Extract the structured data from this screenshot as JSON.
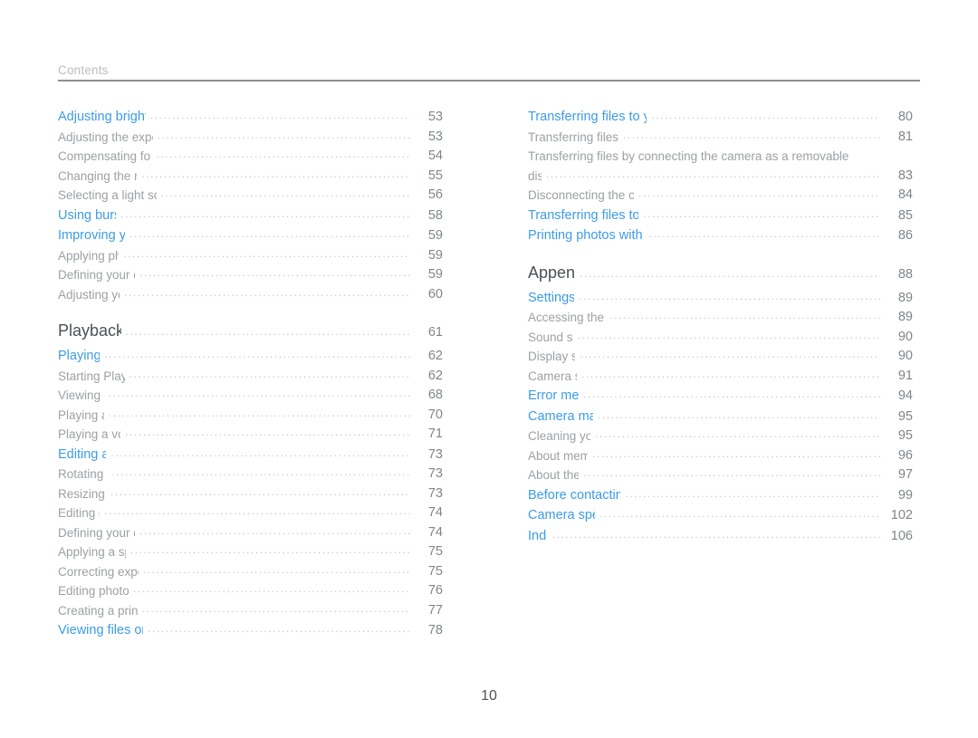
{
  "document": {
    "header_label": "Contents",
    "folio": "10",
    "accent_color": "#3c9ce8",
    "topic_color": "#9ba1a5",
    "section_color": "#4a5156",
    "page_number_color": "#7f868b",
    "rule_color": "#8a8f93"
  },
  "columns": {
    "left": [
      {
        "kind": "chapter",
        "label": "Adjusting brightness and colour",
        "page": "53"
      },
      {
        "kind": "topic",
        "label": "Adjusting the exposure manually (EV)",
        "page": "53"
      },
      {
        "kind": "topic",
        "label": "Compensating for backlighting (ACB)",
        "page": "54"
      },
      {
        "kind": "topic",
        "label": "Changing the metering option",
        "page": "55"
      },
      {
        "kind": "topic",
        "label": "Selecting a light source (White balance)",
        "page": "56"
      },
      {
        "kind": "chapter",
        "label": "Using burst modes",
        "page": "58"
      },
      {
        "kind": "chapter",
        "label": "Improving your photos",
        "page": "59"
      },
      {
        "kind": "topic",
        "label": "Applying photo styles",
        "page": "59"
      },
      {
        "kind": "topic",
        "label": "Defining your own RGB tone",
        "page": "59"
      },
      {
        "kind": "topic",
        "label": "Adjusting your photos",
        "page": "60"
      },
      {
        "kind": "section",
        "label": "Playback/Editing",
        "page": "61"
      },
      {
        "kind": "chapter",
        "label": "Playing back",
        "page": "62"
      },
      {
        "kind": "topic",
        "label": "Starting Playback mode",
        "page": "62"
      },
      {
        "kind": "topic",
        "label": "Viewing photos",
        "page": "68"
      },
      {
        "kind": "topic",
        "label": "Playing a video",
        "page": "70"
      },
      {
        "kind": "topic",
        "label": "Playing a voice memo",
        "page": "71"
      },
      {
        "kind": "chapter",
        "label": "Editing a photo",
        "page": "73"
      },
      {
        "kind": "topic",
        "label": "Rotating a photo",
        "page": "73"
      },
      {
        "kind": "topic",
        "label": "Resizing photos",
        "page": "73"
      },
      {
        "kind": "topic",
        "label": "Editing colour",
        "page": "74"
      },
      {
        "kind": "topic",
        "label": "Defining your own RGB tone",
        "page": "74"
      },
      {
        "kind": "topic",
        "label": "Applying a special effect",
        "page": "75"
      },
      {
        "kind": "topic",
        "label": "Correcting exposure problems",
        "page": "75"
      },
      {
        "kind": "topic",
        "label": "Editing photos of portraits",
        "page": "76"
      },
      {
        "kind": "topic",
        "label": "Creating a print order (DPOF)",
        "page": "77"
      },
      {
        "kind": "chapter",
        "label": "Viewing files on a TV or HDTV",
        "page": "78"
      }
    ],
    "right": [
      {
        "kind": "chapter",
        "label": "Transferring files to your computer (for Windows)",
        "page": "80"
      },
      {
        "kind": "topic",
        "label": "Transferring files using Intelli-studio",
        "page": "81"
      },
      {
        "kind": "topic_wrapped",
        "label_line1": "Transferring files by connecting the camera as a removable",
        "label_line2": "disk",
        "page": "83"
      },
      {
        "kind": "topic",
        "label": "Disconnecting the camera (for Windows XP)",
        "page": "84"
      },
      {
        "kind": "chapter",
        "label": "Transferring files to your computer (for Mac)",
        "page": "85"
      },
      {
        "kind": "chapter",
        "label": "Printing photos with a photo printer (PictBridge)",
        "page": "86"
      },
      {
        "kind": "section",
        "label": "Appendixes",
        "page": "88"
      },
      {
        "kind": "chapter",
        "label": "Settings menu",
        "page": "89"
      },
      {
        "kind": "topic",
        "label": "Accessing the settings menu",
        "page": "89"
      },
      {
        "kind": "topic",
        "label": "Sound settings",
        "page": "90"
      },
      {
        "kind": "topic",
        "label": "Display settings",
        "page": "90"
      },
      {
        "kind": "topic",
        "label": "Camera settings",
        "page": "91"
      },
      {
        "kind": "chapter",
        "label": "Error messages",
        "page": "94"
      },
      {
        "kind": "chapter",
        "label": "Camera maintenance",
        "page": "95"
      },
      {
        "kind": "topic",
        "label": "Cleaning your camera",
        "page": "95"
      },
      {
        "kind": "topic",
        "label": "About memory cards",
        "page": "96"
      },
      {
        "kind": "topic",
        "label": "About the battery",
        "page": "97"
      },
      {
        "kind": "chapter",
        "label": "Before contacting a service centre",
        "page": "99"
      },
      {
        "kind": "chapter",
        "label": "Camera specifications",
        "page": "102"
      },
      {
        "kind": "chapter",
        "label": "Index",
        "page": "106"
      }
    ]
  }
}
